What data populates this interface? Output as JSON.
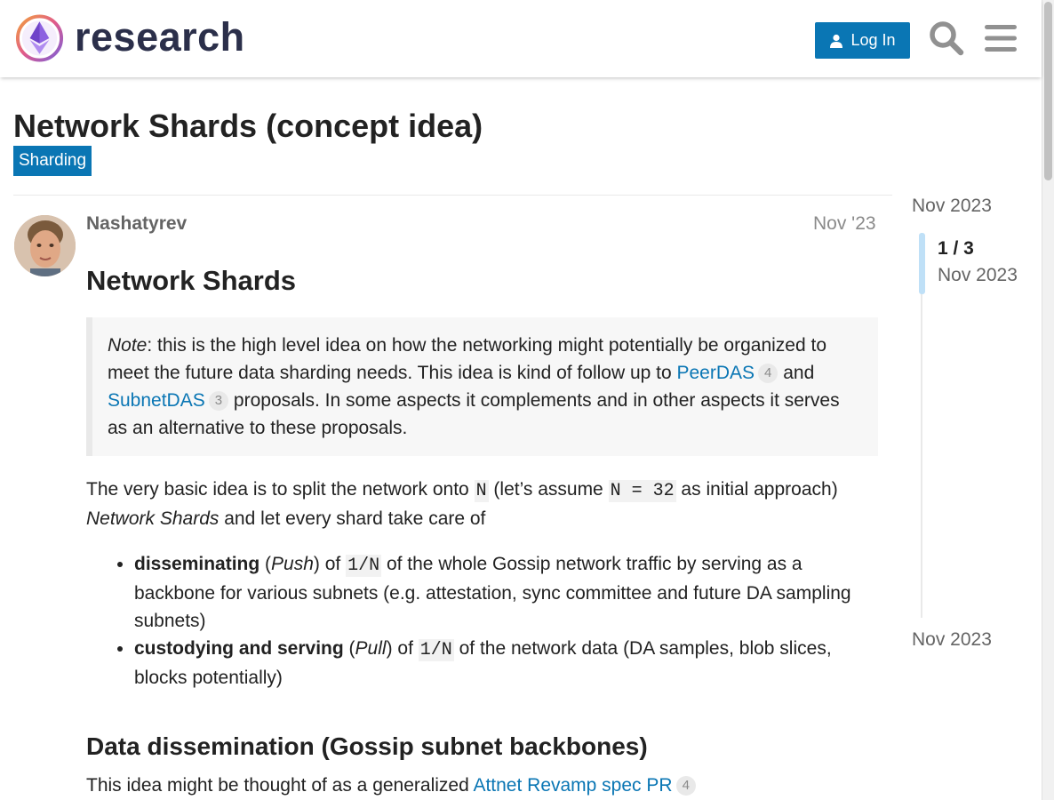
{
  "header": {
    "logo_text": "research",
    "login_label": "Log In",
    "search_icon": "search-icon",
    "menu_icon": "hamburger-menu-icon"
  },
  "topic": {
    "title": "Network Shards (concept idea)",
    "category": "Sharding",
    "category_color": "#0a76b4"
  },
  "post": {
    "author": "Nashatyrev",
    "date": "Nov '23",
    "heading": "Network Shards",
    "quote": {
      "note_label": "Note",
      "text1": ": this is the high level idea on how the networking might potentially be organized to meet the future data sharding needs. This idea is kind of follow up to ",
      "link1": "PeerDAS",
      "link1_count": "4",
      "text2": " and ",
      "link2": "SubnetDAS",
      "link2_count": "3",
      "text3": " proposals. In some aspects it complements and in other aspects it serves as an alternative to these proposals."
    },
    "para1": {
      "t1": "The very basic idea is to split the network onto ",
      "code1": "N",
      "t2": " (let’s assume ",
      "code2": "N = 32",
      "t3": " as initial approach) ",
      "em": "Network Shards",
      "t4": " and let every shard take care of"
    },
    "bullets": [
      {
        "strong": "disseminating",
        "t1": " (",
        "em": "Push",
        "t2": ") of ",
        "code": "1/N",
        "t3": " of the whole Gossip network traffic by serving as a backbone for various subnets (e.g. attestation, sync committee and future DA sampling subnets)"
      },
      {
        "strong": "custodying and serving",
        "t1": " (",
        "em": "Pull",
        "t2": ") of ",
        "code": "1/N",
        "t3": " of the network data (DA samples, blob slices, blocks potentially)"
      }
    ],
    "section2_heading": "Data dissemination (Gossip subnet backbones)",
    "section2_text": "This idea might be thought of as a generalized ",
    "section2_link": "Attnet Revamp spec PR",
    "section2_link_count": "4"
  },
  "timeline": {
    "top_date": "Nov 2023",
    "position": "1 / 3",
    "current_date": "Nov 2023",
    "bottom_date": "Nov 2023"
  },
  "colors": {
    "accent": "#0a76b4",
    "brand_text": "#2b2f4a"
  }
}
